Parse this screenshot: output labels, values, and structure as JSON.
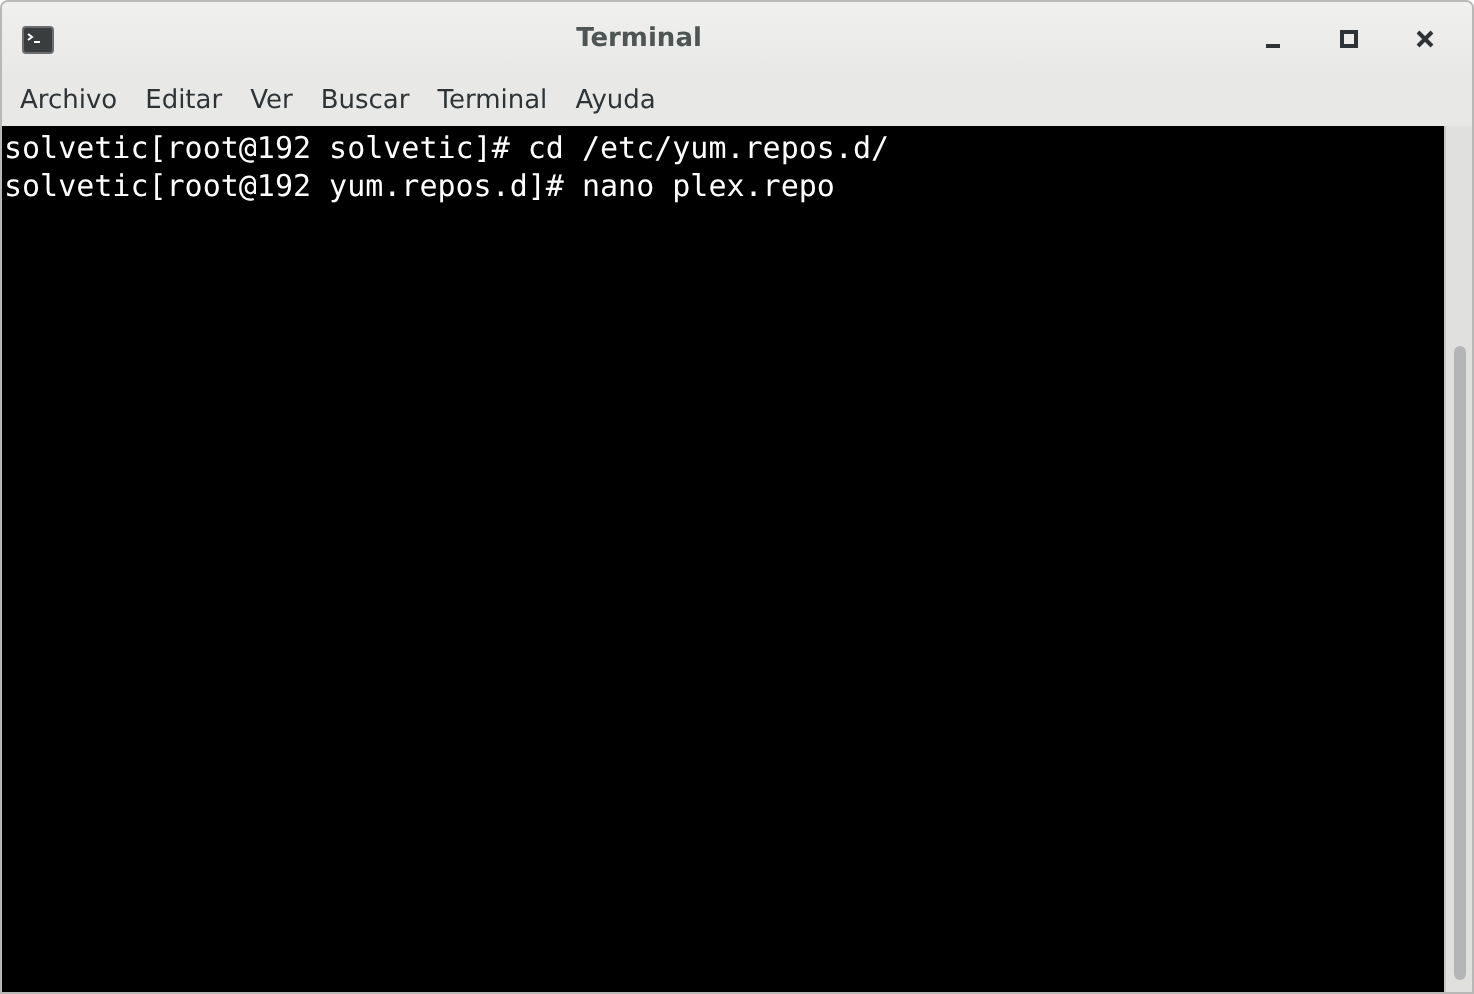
{
  "window": {
    "title": "Terminal"
  },
  "menu": [
    "Archivo",
    "Editar",
    "Ver",
    "Buscar",
    "Terminal",
    "Ayuda"
  ],
  "terminal": {
    "lines": [
      "solvetic[root@192 solvetic]# cd /etc/yum.repos.d/",
      "solvetic[root@192 yum.repos.d]# nano plex.repo"
    ]
  }
}
